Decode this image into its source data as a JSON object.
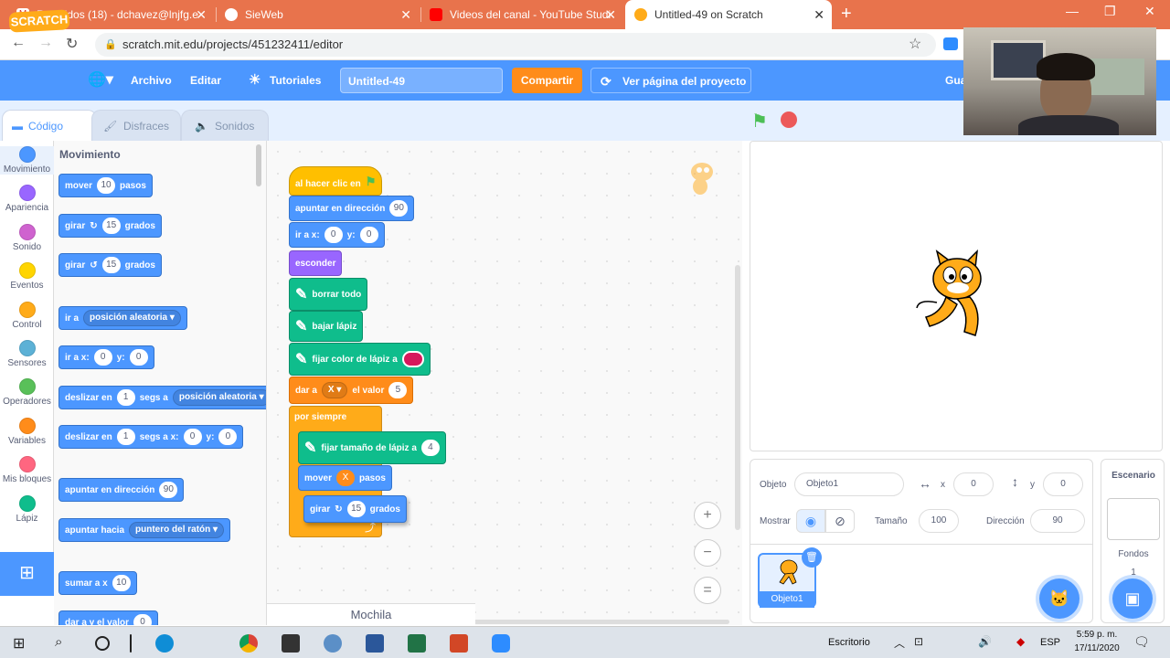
{
  "browser": {
    "tabs": [
      {
        "label": "Recibidos (18) - dchavez@lnjfg.e",
        "color": "#d93025"
      },
      {
        "label": "SieWeb",
        "color": "#e57373"
      },
      {
        "label": "Videos del canal - YouTube Studi",
        "color": "#ff0000"
      },
      {
        "label": "Untitled-49 on Scratch",
        "color": "#ffab19"
      }
    ],
    "new_tab": "+",
    "url": "scratch.mit.edu/projects/451232411/editor"
  },
  "menu": {
    "logo": "SCRATCH",
    "archivo": "Archivo",
    "editar": "Editar",
    "tutoriales": "Tutoriales",
    "project_title": "Untitled-49",
    "share": "Compartir",
    "view_page": "Ver página del proyecto",
    "guardar": "Gua"
  },
  "editor_tabs": {
    "code": "Código",
    "costumes": "Disfraces",
    "sounds": "Sonidos"
  },
  "categories": [
    {
      "label": "Movimiento",
      "color": "#4c97ff"
    },
    {
      "label": "Apariencia",
      "color": "#9966ff"
    },
    {
      "label": "Sonido",
      "color": "#cf63cf"
    },
    {
      "label": "Eventos",
      "color": "#ffd500"
    },
    {
      "label": "Control",
      "color": "#ffab19"
    },
    {
      "label": "Sensores",
      "color": "#5cb1d6"
    },
    {
      "label": "Operadores",
      "color": "#59c059"
    },
    {
      "label": "Variables",
      "color": "#ff8c1a"
    },
    {
      "label": "Mis bloques",
      "color": "#ff6680"
    },
    {
      "label": "Lápiz",
      "color": "#0fbd8c"
    }
  ],
  "palette": {
    "heading": "Movimiento",
    "mover": {
      "a": "mover",
      "n": "10",
      "b": "pasos"
    },
    "girar_r": {
      "a": "girar",
      "n": "15",
      "b": "grados"
    },
    "girar_l": {
      "a": "girar",
      "n": "15",
      "b": "grados"
    },
    "ir_a": {
      "a": "ir a",
      "d": "posición aleatoria"
    },
    "ir_a_xy": {
      "a": "ir a x:",
      "x": "0",
      "b": "y:",
      "y": "0"
    },
    "deslizar1": {
      "a": "deslizar en",
      "n": "1",
      "b": "segs a",
      "d": "posición aleatoria"
    },
    "deslizar2": {
      "a": "deslizar en",
      "n": "1",
      "b": "segs a x:",
      "x": "0",
      "c": "y:",
      "y": "0"
    },
    "apuntar": {
      "a": "apuntar en dirección",
      "n": "90"
    },
    "apuntar_hacia": {
      "a": "apuntar hacia",
      "d": "puntero del ratón"
    },
    "sumar": {
      "a": "sumar a x",
      "n": "10"
    },
    "dar_a_y": {
      "a": "dar a y el valor",
      "n": "0"
    }
  },
  "script": {
    "hat": "al hacer clic en",
    "point": {
      "a": "apuntar en dirección",
      "n": "90"
    },
    "goto": {
      "a": "ir a x:",
      "x": "0",
      "b": "y:",
      "y": "0"
    },
    "hide": "esconder",
    "clear": "borrar todo",
    "pendown": "bajar lápiz",
    "pencolor": "fijar color de lápiz a",
    "pencolor_value": "#d6185c",
    "setvar": {
      "a": "dar a",
      "v": "X",
      "b": "el valor",
      "n": "5"
    },
    "forever": "por siempre",
    "pensize": {
      "a": "fijar tamaño de lápiz a",
      "n": "4"
    },
    "move": {
      "a": "mover",
      "v": "X",
      "b": "pasos"
    },
    "turn": {
      "a": "girar",
      "n": "15",
      "b": "grados"
    }
  },
  "mochila": "Mochila",
  "zoom": {
    "in": "+",
    "out": "−",
    "reset": "="
  },
  "sprite": {
    "objeto_label": "Objeto",
    "objeto_name": "Objeto1",
    "x_label": "x",
    "x": "0",
    "y_label": "y",
    "y": "0",
    "mostrar": "Mostrar",
    "tamano_label": "Tamaño",
    "tamano": "100",
    "direccion_label": "Dirección",
    "direccion": "90",
    "thumb_name": "Objeto1"
  },
  "backdrop": {
    "title": "Escenario",
    "fondos": "Fondos",
    "count": "1"
  },
  "taskbar": {
    "escritorio": "Escritorio",
    "lang": "ESP",
    "time": "5:59 p. m.",
    "date": "17/11/2020"
  }
}
